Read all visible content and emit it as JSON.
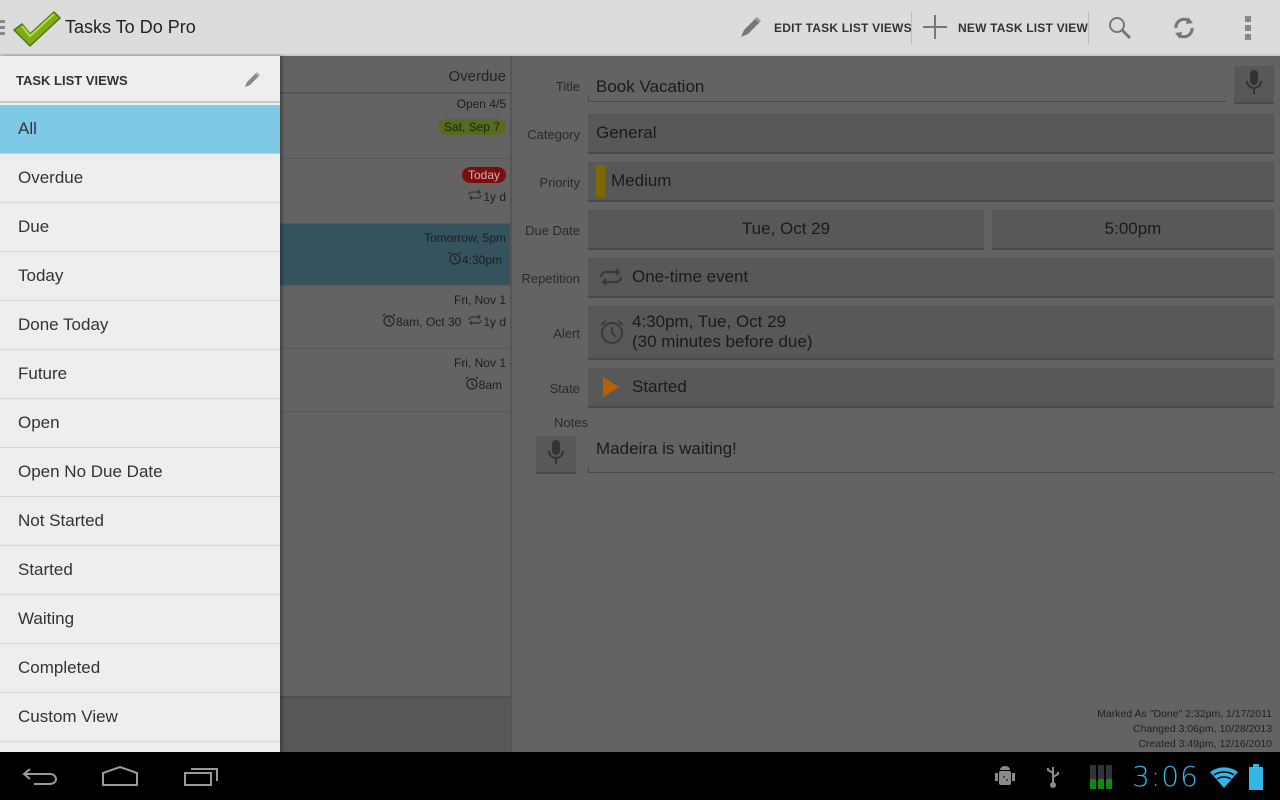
{
  "action_bar": {
    "app_title": "Tasks To Do Pro",
    "logo_icon": "checkmark-logo-icon",
    "edit_views_label": "EDIT TASK LIST VIEWS",
    "new_view_label": "NEW TASK LIST VIEW",
    "icons": [
      "pencil-icon",
      "plus-icon",
      "search-icon",
      "sync-icon",
      "overflow-menu-icon"
    ]
  },
  "drawer": {
    "header": "TASK LIST VIEWS",
    "items": [
      {
        "label": "All",
        "selected": true
      },
      {
        "label": "Overdue"
      },
      {
        "label": "Due"
      },
      {
        "label": "Today"
      },
      {
        "label": "Done Today"
      },
      {
        "label": "Future"
      },
      {
        "label": "Open"
      },
      {
        "label": "Open No Due Date"
      },
      {
        "label": "Not Started"
      },
      {
        "label": "Started"
      },
      {
        "label": "Waiting"
      },
      {
        "label": "Completed"
      },
      {
        "label": "Custom View"
      }
    ]
  },
  "task_list": {
    "header": "Overdue",
    "rows": [
      {
        "line1": "Open 4/5",
        "badge": "Sat, Sep 7",
        "badge_color": "#566b1f"
      },
      {
        "badge": "Today",
        "badge_color": "#7d0d0d",
        "repeat": "1y d"
      },
      {
        "line1": "Tomorrow, 5pm",
        "alarm": "4:30pm",
        "selected": true
      },
      {
        "line1": "Fri, Nov 1",
        "alarm": "8am, Oct 30",
        "repeat": "1y d"
      },
      {
        "line1": "Fri, Nov 1",
        "alarm": "8am"
      }
    ]
  },
  "detail": {
    "labels": {
      "title": "Title",
      "category": "Category",
      "priority": "Priority",
      "due_date": "Due Date",
      "repetition": "Repetition",
      "alert": "Alert",
      "state": "State",
      "notes": "Notes"
    },
    "title": "Book Vacation",
    "category": "General",
    "priority": "Medium",
    "priority_color": "#7a6a00",
    "due_date": "Tue, Oct 29",
    "due_time": "5:00pm",
    "repetition": "One-time event",
    "alert_line1": "4:30pm, Tue, Oct 29",
    "alert_line2": "(30 minutes before due)",
    "state": "Started",
    "state_color": "#b86000",
    "notes": "Madeira is waiting!",
    "meta": {
      "marked_done": "Marked As \"Done\" 2:32pm, 1/17/2011",
      "changed": "Changed 3:06pm, 10/28/2013",
      "created": "Created 3:49pm, 12/16/2010"
    }
  },
  "system_bar": {
    "clock": "3:06",
    "nav_icons": [
      "back-icon",
      "home-icon",
      "recents-icon"
    ],
    "status_icons": [
      "android-debug-icon",
      "usb-icon",
      "signal-bars-icon",
      "wifi-icon",
      "battery-icon"
    ],
    "accent": "#33b5e5"
  }
}
